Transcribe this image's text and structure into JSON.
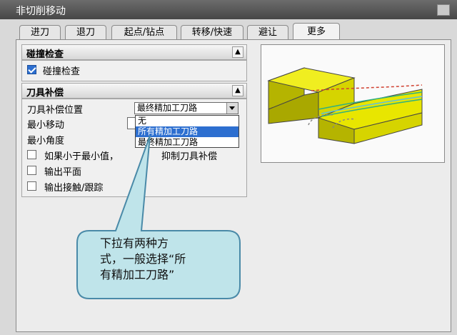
{
  "window": {
    "title": "非切削移动"
  },
  "tabs": [
    "进刀",
    "退刀",
    "起点/钻点",
    "转移/快速",
    "避让",
    "更多"
  ],
  "active_tab": "更多",
  "collision_group": {
    "title": "碰撞检查",
    "checkbox_label": "碰撞检查",
    "checked": true
  },
  "cutter_comp_group": {
    "title": "刀具补偿",
    "position_label": "刀具补偿位置",
    "position_value": "最终精加工刀路",
    "dropdown_options": [
      "无",
      "所有精加工刀路",
      "最终精加工刀路"
    ],
    "highlighted_option": "所有精加工刀路",
    "min_move_label": "最小移动",
    "min_angle_label": "最小角度",
    "suppress_label": "如果小于最小值，",
    "suppress_label_tail": "抑制刀具补偿",
    "output_plane_label": "输出平面",
    "output_contact_label": "输出接触/跟踪"
  },
  "callout": {
    "text_line1": "下拉有两种方",
    "text_line2": "式，一般选择“所",
    "text_line3": "有精加工刀路”"
  },
  "colors": {
    "highlight": "#2d6fd0",
    "callout_fill": "#bfe4ea",
    "callout_stroke": "#4a8aa8",
    "block_yellow": "#e8e600",
    "block_dark": "#a9a800"
  }
}
